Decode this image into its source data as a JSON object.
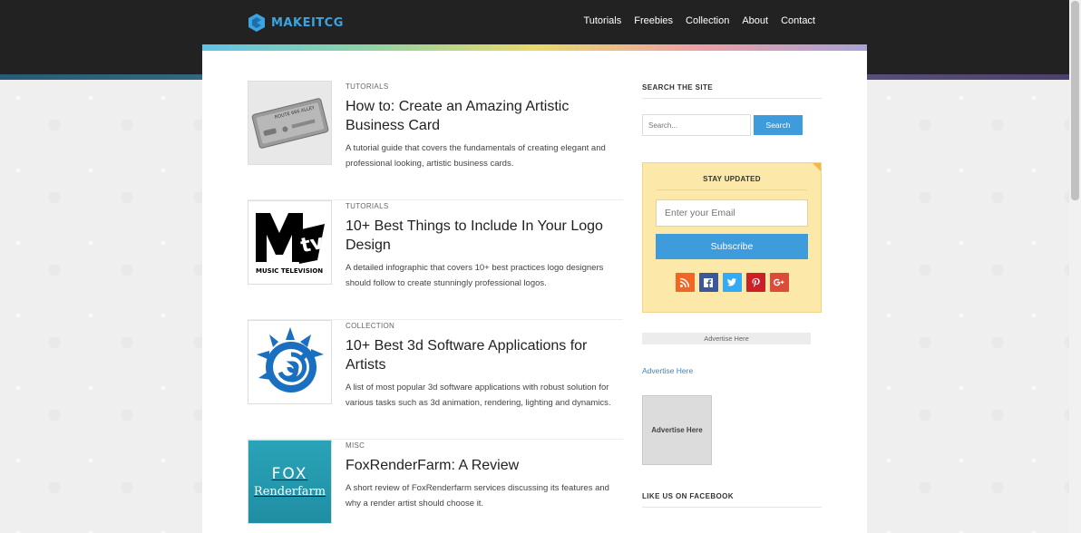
{
  "brand": {
    "name": "MAKEITCG",
    "color": "#3ba4e0"
  },
  "nav": {
    "items": [
      "Tutorials",
      "Freebies",
      "Collection",
      "About",
      "Contact"
    ]
  },
  "posts": [
    {
      "category": "TUTORIALS",
      "title": "How to: Create an Amazing Artistic Business Card",
      "excerpt": "A tutorial guide that covers the fundamentals of creating elegant and professional looking, artistic business cards.",
      "thumb_icon": "metal-business-card-icon",
      "thumb_text": "ROUTE 666 ALLEY"
    },
    {
      "category": "TUTORIALS",
      "title": "10+ Best Things to Include In Your Logo Design",
      "excerpt": "A detailed infographic that covers 10+ best practices logo designers should follow to create stunningly professional logos.",
      "thumb_icon": "mtv-logo-icon",
      "thumb_text": "MUSIC TELEVISION"
    },
    {
      "category": "COLLECTION",
      "title": "10+ Best 3d Software Applications for Artists",
      "excerpt": "A list of most popular 3d software applications with robust solution for various tasks such as 3d animation, rendering, lighting and dynamics.",
      "thumb_icon": "blue-swirl-creature-icon"
    },
    {
      "category": "MISC",
      "title": "FoxRenderFarm: A Review",
      "excerpt": "A short review of FoxRenderfarm services discussing its features and why a render artist should choose it.",
      "thumb_icon": "fox-renderfarm-logo",
      "thumb_line1": "FOX",
      "thumb_line2": "Renderfarm"
    }
  ],
  "sidebar": {
    "search_title": "SEARCH THE SITE",
    "search_placeholder": "Search...",
    "search_button": "Search",
    "subscribe_title": "STAY UPDATED",
    "email_placeholder": "Enter your Email",
    "subscribe_button": "Subscribe",
    "social": [
      {
        "icon": "rss-icon",
        "glyph": "◉",
        "color": "#f26522"
      },
      {
        "icon": "facebook-icon",
        "glyph": "f",
        "color": "#3b5998"
      },
      {
        "icon": "twitter-icon",
        "glyph": "t",
        "color": "#33aaf3"
      },
      {
        "icon": "pinterest-icon",
        "glyph": "P",
        "color": "#cb2027"
      },
      {
        "icon": "google-plus-icon",
        "glyph": "g+",
        "color": "#dd4b39"
      }
    ],
    "ad_strip": "Advertise Here",
    "ad_link": "Advertise Here",
    "ad_box": "Advertise Here",
    "facebook_title": "LIKE US ON FACEBOOK"
  }
}
